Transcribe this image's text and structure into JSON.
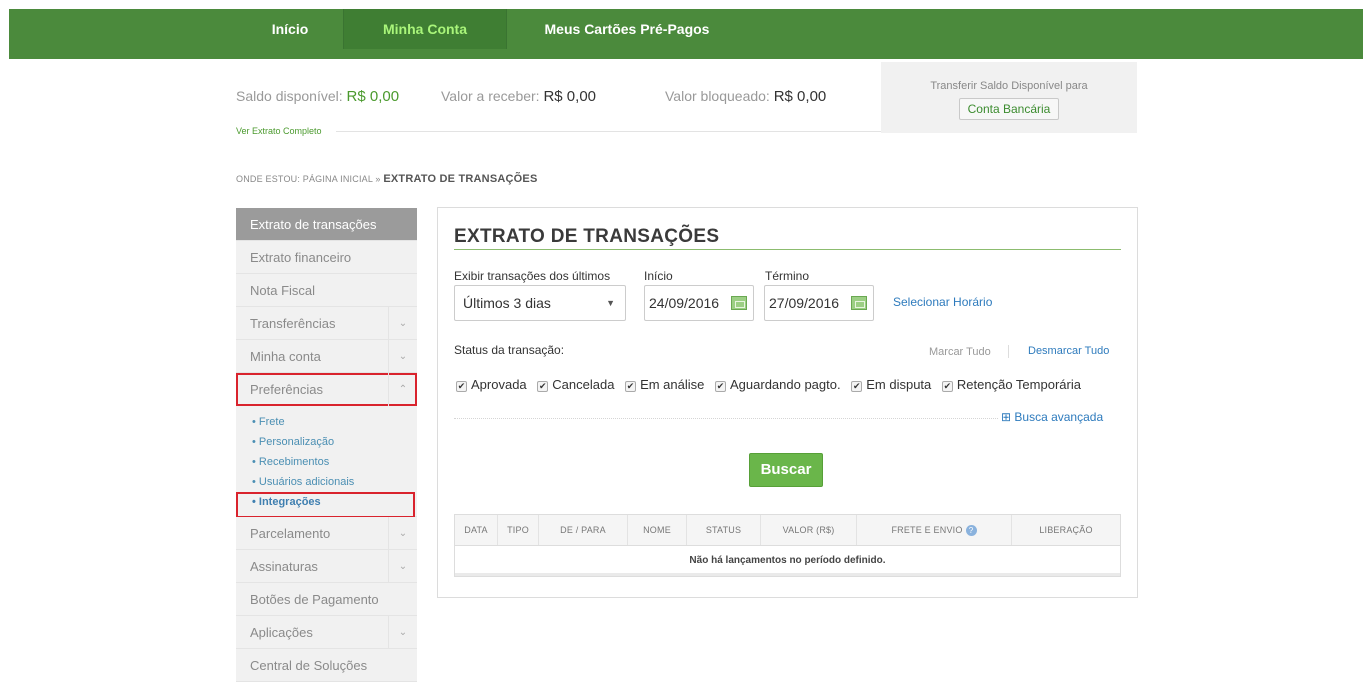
{
  "nav": {
    "inicio": "Início",
    "minha_conta": "Minha Conta",
    "cartoes": "Meus Cartões Pré-Pagos"
  },
  "balance": {
    "saldo_label": "Saldo disponível:",
    "saldo_value": "R$ 0,00",
    "receber_label": "Valor a receber:",
    "receber_value": "R$ 0,00",
    "bloqueado_label": "Valor bloqueado:",
    "bloqueado_value": "R$ 0,00",
    "transfer_label": "Transferir Saldo Disponível para",
    "transfer_button": "Conta Bancária",
    "extrato_link": "Ver Extrato Completo"
  },
  "breadcrumb": {
    "prefix": "ONDE ESTOU: PÁGINA INICIAL »",
    "current": "EXTRATO DE TRANSAÇÕES"
  },
  "sidebar": {
    "items": [
      {
        "label": "Extrato de transações"
      },
      {
        "label": "Extrato financeiro"
      },
      {
        "label": "Nota Fiscal"
      },
      {
        "label": "Transferências"
      },
      {
        "label": "Minha conta"
      },
      {
        "label": "Preferências"
      },
      {
        "label": "Parcelamento"
      },
      {
        "label": "Assinaturas"
      },
      {
        "label": "Botões de Pagamento"
      },
      {
        "label": "Aplicações"
      },
      {
        "label": "Central de Soluções"
      }
    ],
    "submenu": [
      "• Frete",
      "• Personalização",
      "• Recebimentos",
      "• Usuários adicionais",
      "• Integrações"
    ]
  },
  "panel": {
    "title": "EXTRATO DE TRANSAÇÕES",
    "period_label": "Exibir transações dos últimos",
    "period_value": "Últimos 3 dias",
    "start_label": "Início",
    "start_value": "24/09/2016",
    "end_label": "Término",
    "end_value": "27/09/2016",
    "select_time": "Selecionar Horário",
    "status_label": "Status da transação:",
    "mark_all": "Marcar Tudo",
    "unmark_all": "Desmarcar Tudo",
    "statuses": [
      "Aprovada",
      "Cancelada",
      "Em análise",
      "Aguardando pagto.",
      "Em disputa",
      "Retenção Temporária"
    ],
    "advanced": "⊞ Busca avançada",
    "search_button": "Buscar",
    "table_headers": [
      "DATA",
      "TIPO",
      "DE / PARA",
      "NOME",
      "STATUS",
      "VALOR (R$)",
      "FRETE E ENVIO",
      "LIBERAÇÃO"
    ],
    "empty_message": "Não há lançamentos no período definido."
  },
  "colors": {
    "nav_bg": "#4b8a3c",
    "accent_green": "#6ab64a",
    "highlight_red": "#d9232d"
  }
}
